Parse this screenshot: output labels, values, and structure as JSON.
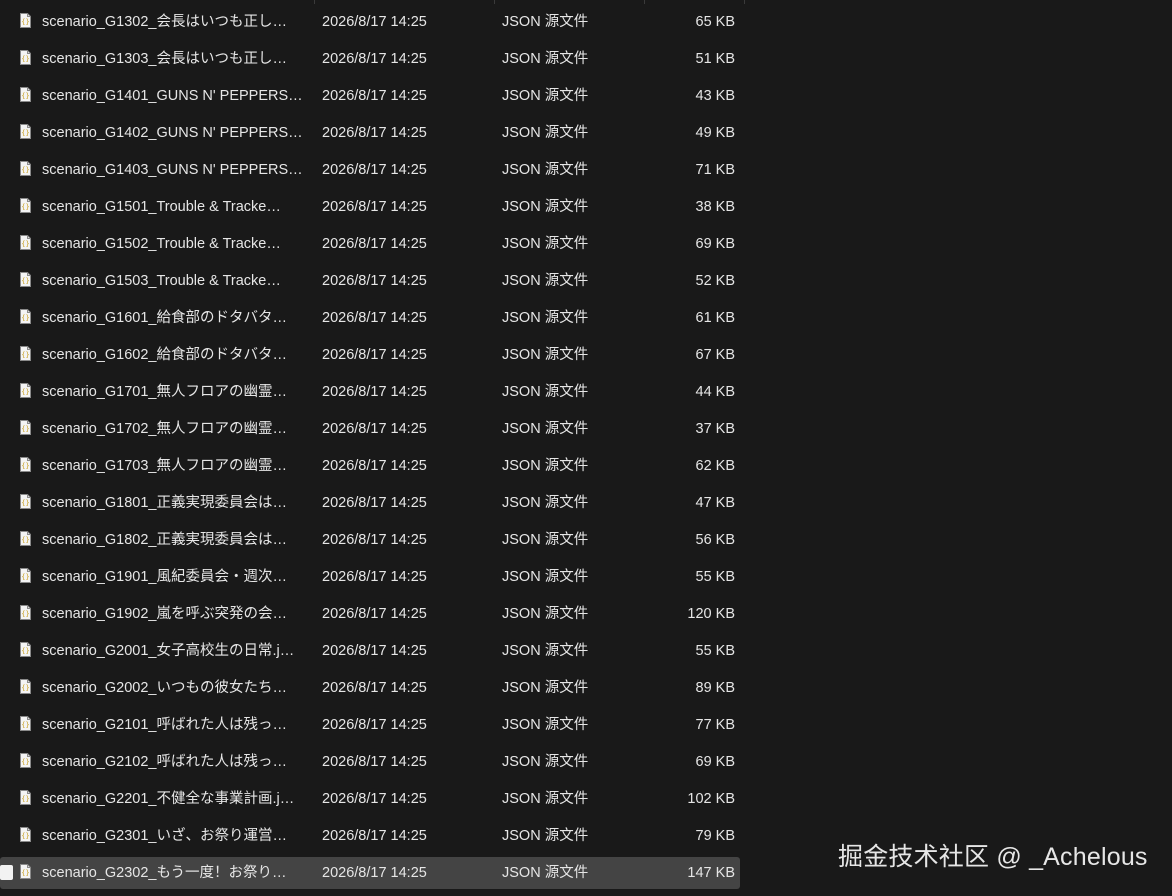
{
  "files": [
    {
      "name": "scenario_G1302_会長はいつも正し…",
      "date": "2026/8/17 14:25",
      "type": "JSON 源文件",
      "size": "65 KB"
    },
    {
      "name": "scenario_G1303_会長はいつも正し…",
      "date": "2026/8/17 14:25",
      "type": "JSON 源文件",
      "size": "51 KB"
    },
    {
      "name": "scenario_G1401_GUNS N' PEPPERS…",
      "date": "2026/8/17 14:25",
      "type": "JSON 源文件",
      "size": "43 KB"
    },
    {
      "name": "scenario_G1402_GUNS N' PEPPERS…",
      "date": "2026/8/17 14:25",
      "type": "JSON 源文件",
      "size": "49 KB"
    },
    {
      "name": "scenario_G1403_GUNS N' PEPPERS…",
      "date": "2026/8/17 14:25",
      "type": "JSON 源文件",
      "size": "71 KB"
    },
    {
      "name": "scenario_G1501_Trouble & Tracke…",
      "date": "2026/8/17 14:25",
      "type": "JSON 源文件",
      "size": "38 KB"
    },
    {
      "name": "scenario_G1502_Trouble & Tracke…",
      "date": "2026/8/17 14:25",
      "type": "JSON 源文件",
      "size": "69 KB"
    },
    {
      "name": "scenario_G1503_Trouble & Tracke…",
      "date": "2026/8/17 14:25",
      "type": "JSON 源文件",
      "size": "52 KB"
    },
    {
      "name": "scenario_G1601_給食部のドタバタ…",
      "date": "2026/8/17 14:25",
      "type": "JSON 源文件",
      "size": "61 KB"
    },
    {
      "name": "scenario_G1602_給食部のドタバタ…",
      "date": "2026/8/17 14:25",
      "type": "JSON 源文件",
      "size": "67 KB"
    },
    {
      "name": "scenario_G1701_無人フロアの幽霊…",
      "date": "2026/8/17 14:25",
      "type": "JSON 源文件",
      "size": "44 KB"
    },
    {
      "name": "scenario_G1702_無人フロアの幽霊…",
      "date": "2026/8/17 14:25",
      "type": "JSON 源文件",
      "size": "37 KB"
    },
    {
      "name": "scenario_G1703_無人フロアの幽霊…",
      "date": "2026/8/17 14:25",
      "type": "JSON 源文件",
      "size": "62 KB"
    },
    {
      "name": "scenario_G1801_正義実現委員会は…",
      "date": "2026/8/17 14:25",
      "type": "JSON 源文件",
      "size": "47 KB"
    },
    {
      "name": "scenario_G1802_正義実現委員会は…",
      "date": "2026/8/17 14:25",
      "type": "JSON 源文件",
      "size": "56 KB"
    },
    {
      "name": "scenario_G1901_風紀委員会・週次…",
      "date": "2026/8/17 14:25",
      "type": "JSON 源文件",
      "size": "55 KB"
    },
    {
      "name": "scenario_G1902_嵐を呼ぶ突発の会…",
      "date": "2026/8/17 14:25",
      "type": "JSON 源文件",
      "size": "120 KB"
    },
    {
      "name": "scenario_G2001_女子高校生の日常.j…",
      "date": "2026/8/17 14:25",
      "type": "JSON 源文件",
      "size": "55 KB"
    },
    {
      "name": "scenario_G2002_いつもの彼女たち…",
      "date": "2026/8/17 14:25",
      "type": "JSON 源文件",
      "size": "89 KB"
    },
    {
      "name": "scenario_G2101_呼ばれた人は残っ…",
      "date": "2026/8/17 14:25",
      "type": "JSON 源文件",
      "size": "77 KB"
    },
    {
      "name": "scenario_G2102_呼ばれた人は残っ…",
      "date": "2026/8/17 14:25",
      "type": "JSON 源文件",
      "size": "69 KB"
    },
    {
      "name": "scenario_G2201_不健全な事業計画.j…",
      "date": "2026/8/17 14:25",
      "type": "JSON 源文件",
      "size": "102 KB"
    },
    {
      "name": "scenario_G2301_いざ、お祭り運営…",
      "date": "2026/8/17 14:25",
      "type": "JSON 源文件",
      "size": "79 KB"
    },
    {
      "name": "scenario_G2302_もう一度！お祭り…",
      "date": "2026/8/17 14:25",
      "type": "JSON 源文件",
      "size": "147 KB",
      "selected": true
    }
  ],
  "watermark": "掘金技术社区 @ _Achelous",
  "icon": "json-file-icon",
  "colors": {
    "background": "#191919",
    "text": "#e6e6e6",
    "selected_row": "#444444",
    "icon_page": "#f4f4f4",
    "icon_braces": "#c9a227"
  }
}
